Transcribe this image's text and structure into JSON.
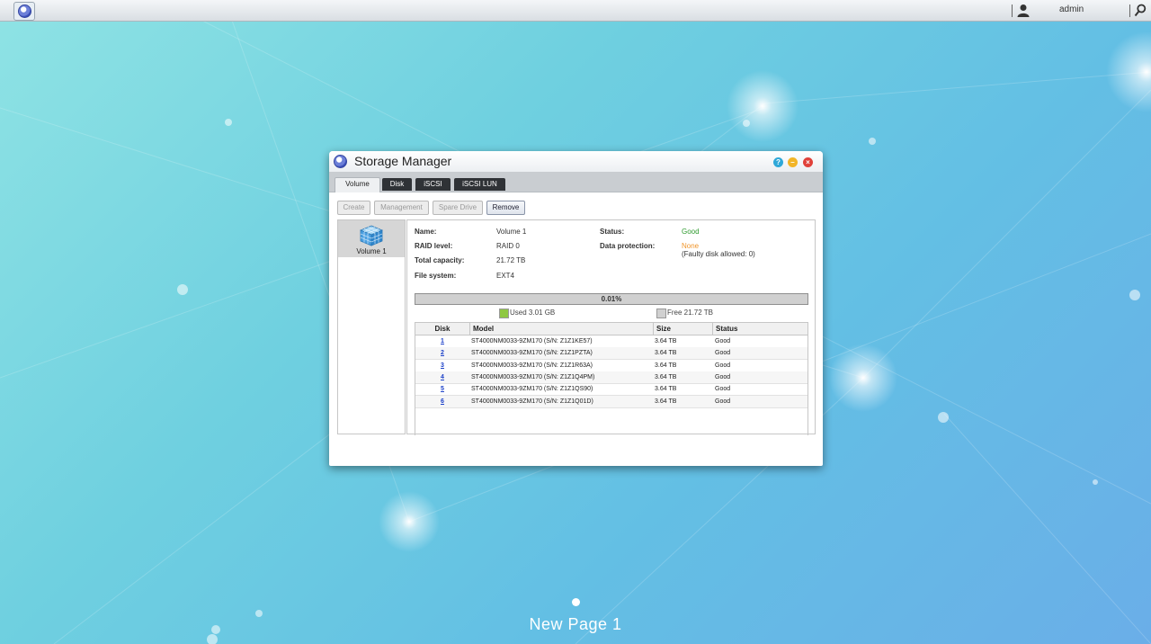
{
  "topbar": {
    "user": "admin"
  },
  "desktop": {
    "page_label": "New Page 1"
  },
  "window": {
    "title": "Storage Manager",
    "help_glyph": "?",
    "min_glyph": "–",
    "close_glyph": "×",
    "tabs": [
      "Volume",
      "Disk",
      "iSCSI",
      "iSCSI LUN"
    ],
    "toolbar": {
      "create": "Create",
      "management": "Management",
      "spare": "Spare Drive",
      "remove": "Remove"
    },
    "volume_list": [
      {
        "label": "Volume 1",
        "icon": "cube-icon"
      }
    ],
    "details": {
      "name_label": "Name:",
      "name": "Volume 1",
      "raid_label": "RAID level:",
      "raid": "RAID 0",
      "capacity_label": "Total capacity:",
      "capacity": "21.72 TB",
      "fs_label": "File system:",
      "fs": "EXT4",
      "status_label": "Status:",
      "status": "Good",
      "protection_label": "Data protection:",
      "protection": "None",
      "protection_note": "(Faulty disk allowed: 0)"
    },
    "usage": {
      "percent_text": "0.01%",
      "used_fraction": 0.0001,
      "used_label": "Used 3.01 GB",
      "free_label": "Free 21.72 TB",
      "used_color": "#8fc842",
      "free_color": "#d0d0d0"
    },
    "disk_table": {
      "headers": {
        "disk": "Disk",
        "model": "Model",
        "size": "Size",
        "status": "Status"
      },
      "rows": [
        {
          "disk": "1",
          "model": "ST4000NM0033-9ZM170 (S/N: Z1Z1KE57)",
          "size": "3.64 TB",
          "status": "Good"
        },
        {
          "disk": "2",
          "model": "ST4000NM0033-9ZM170 (S/N: Z1Z1PZTA)",
          "size": "3.64 TB",
          "status": "Good"
        },
        {
          "disk": "3",
          "model": "ST4000NM0033-9ZM170 (S/N: Z1Z1R63A)",
          "size": "3.64 TB",
          "status": "Good"
        },
        {
          "disk": "4",
          "model": "ST4000NM0033-9ZM170 (S/N: Z1Z1Q4PM)",
          "size": "3.64 TB",
          "status": "Good"
        },
        {
          "disk": "5",
          "model": "ST4000NM0033-9ZM170 (S/N: Z1Z1QS90)",
          "size": "3.64 TB",
          "status": "Good"
        },
        {
          "disk": "6",
          "model": "ST4000NM0033-9ZM170 (S/N: Z1Z1Q01D)",
          "size": "3.64 TB",
          "status": "Good"
        }
      ]
    }
  }
}
